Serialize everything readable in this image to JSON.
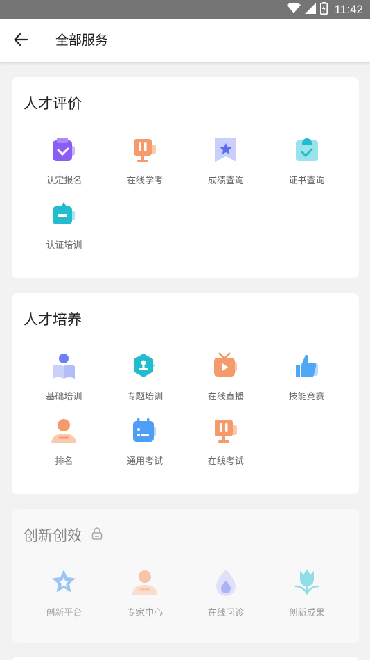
{
  "status_bar": {
    "time": "11:42"
  },
  "app_bar": {
    "title": "全部服务",
    "back_icon": "arrow-left-icon"
  },
  "sections": [
    {
      "title": "人才评价",
      "locked": false,
      "items": [
        {
          "label": "认定报名",
          "icon": "register-icon",
          "color": "#8b5cf6"
        },
        {
          "label": "在线学考",
          "icon": "online-study-icon",
          "color": "#f59a6b"
        },
        {
          "label": "成绩查询",
          "icon": "score-query-icon",
          "color": "#6e7ff5"
        },
        {
          "label": "证书查询",
          "icon": "certificate-query-icon",
          "color": "#3cc8d8"
        },
        {
          "label": "认证培训",
          "icon": "certification-training-icon",
          "color": "#22bccf"
        }
      ]
    },
    {
      "title": "人才培养",
      "locked": false,
      "items": [
        {
          "label": "基础培训",
          "icon": "basic-training-icon",
          "color": "#7a86f0"
        },
        {
          "label": "专题培训",
          "icon": "topic-training-icon",
          "color": "#22bccf"
        },
        {
          "label": "在线直播",
          "icon": "live-broadcast-icon",
          "color": "#f59a6b"
        },
        {
          "label": "技能竞赛",
          "icon": "skill-competition-icon",
          "color": "#4fa8f5"
        },
        {
          "label": "排名",
          "icon": "ranking-icon",
          "color": "#f59a6b"
        },
        {
          "label": "通用考试",
          "icon": "general-exam-icon",
          "color": "#4f9ef5"
        },
        {
          "label": "在线考试",
          "icon": "online-exam-icon",
          "color": "#f59a6b"
        }
      ]
    },
    {
      "title": "创新创效",
      "locked": true,
      "lock_icon": "lock-icon",
      "items": [
        {
          "label": "创新平台",
          "icon": "innovation-platform-icon",
          "color": "#4f9ef5"
        },
        {
          "label": "专家中心",
          "icon": "expert-center-icon",
          "color": "#f59a6b"
        },
        {
          "label": "在线问诊",
          "icon": "online-consultation-icon",
          "color": "#7a86f0"
        },
        {
          "label": "创新成果",
          "icon": "innovation-results-icon",
          "color": "#3cc8d8"
        }
      ]
    }
  ]
}
